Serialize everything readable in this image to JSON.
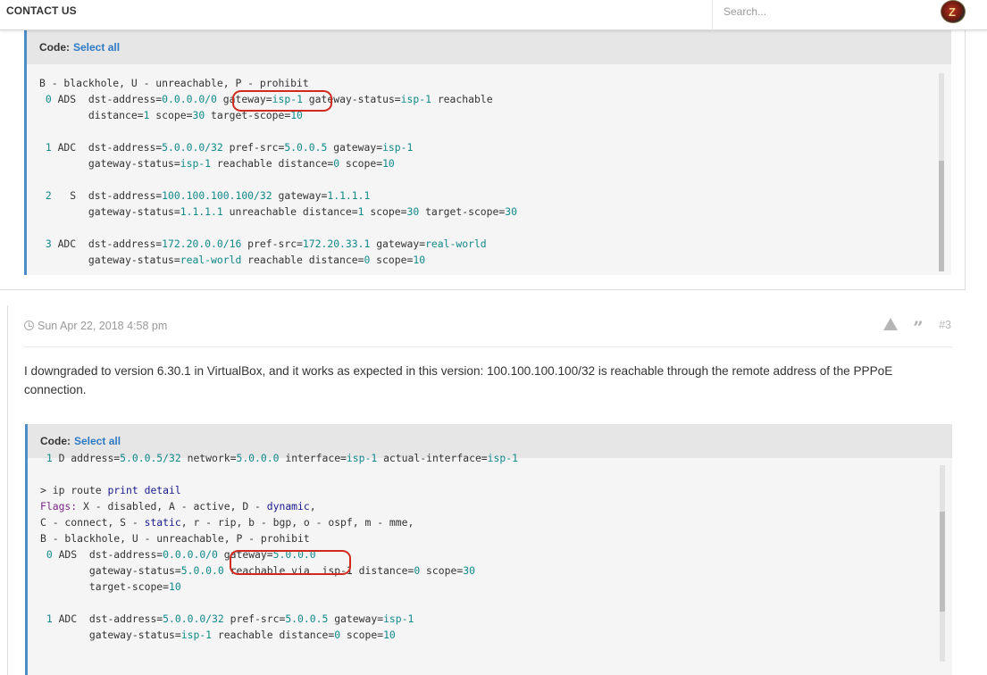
{
  "topbar": {
    "contact_label": "CONTACT US",
    "search_placeholder": "Search...",
    "avatar_letter": "Z"
  },
  "post1": {
    "code_label": "Code:",
    "select_all": "Select all",
    "code_lines": [
      "B - blackhole, U - unreachable, P - prohibit",
      " 0 ADS  dst-address=0.0.0.0/0 gateway=isp-1 gateway-status=isp-1 reachable",
      "        distance=1 scope=30 target-scope=10",
      "",
      " 1 ADC  dst-address=5.0.0.0/32 pref-src=5.0.0.5 gateway=isp-1",
      "        gateway-status=isp-1 reachable distance=0 scope=10",
      "",
      " 2   S  dst-address=100.100.100.100/32 gateway=1.1.1.1",
      "        gateway-status=1.1.1.1 unreachable distance=1 scope=30 target-scope=30",
      "",
      " 3 ADC  dst-address=172.20.0.0/16 pref-src=172.20.33.1 gateway=real-world",
      "        gateway-status=real-world reachable distance=0 scope=10"
    ],
    "scroll_position": 0.62
  },
  "post2": {
    "timestamp": "Sun Apr 22, 2018 4:58 pm",
    "post_number": "#3",
    "body_text": "I downgraded to version 6.30.1 in VirtualBox, and it works as expected in this version: 100.100.100.100/32 is reachable through the remote address of the PPPoE connection.",
    "code_label": "Code:",
    "select_all": "Select all",
    "code_lines": [
      " 1 D address=5.0.0.5/32 network=5.0.0.0 interface=isp-1 actual-interface=isp-1",
      "",
      "> ip route print detail",
      "Flags: X - disabled, A - active, D - dynamic,",
      "C - connect, S - static, r - rip, b - bgp, o - ospf, m - mme,",
      "B - blackhole, U - unreachable, P - prohibit",
      " 0 ADS  dst-address=0.0.0.0/0 gateway=5.0.0.0",
      "        gateway-status=5.0.0.0 reachable via  isp-1 distance=0 scope=30",
      "        target-scope=10",
      "",
      " 1 ADC  dst-address=5.0.0.0/32 pref-src=5.0.0.5 gateway=isp-1",
      "        gateway-status=isp-1 reachable distance=0 scope=10"
    ],
    "scroll_position": 0.45
  },
  "colors": {
    "accent": "#4c8cc7",
    "link": "#2e7ac4",
    "annotation": "#d02a1f",
    "code_value": "#11888a"
  }
}
